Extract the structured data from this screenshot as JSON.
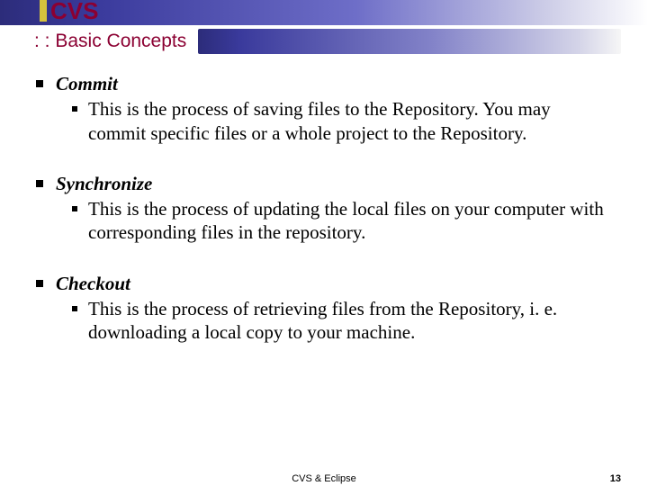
{
  "header": {
    "title": "CVS",
    "subtitle": ": : Basic Concepts"
  },
  "items": [
    {
      "term": "Commit",
      "desc": "This is the process of saving files to the Repository. You may commit specific files or a whole project to the Repository."
    },
    {
      "term": "Synchronize",
      "desc": "This is the process of updating the local files on your computer with corresponding files in the repository."
    },
    {
      "term": "Checkout",
      "desc": "This is the process of retrieving files from the Repository, i. e. downloading a local copy to your machine."
    }
  ],
  "footer": {
    "center": "CVS & Eclipse",
    "page": "13"
  }
}
